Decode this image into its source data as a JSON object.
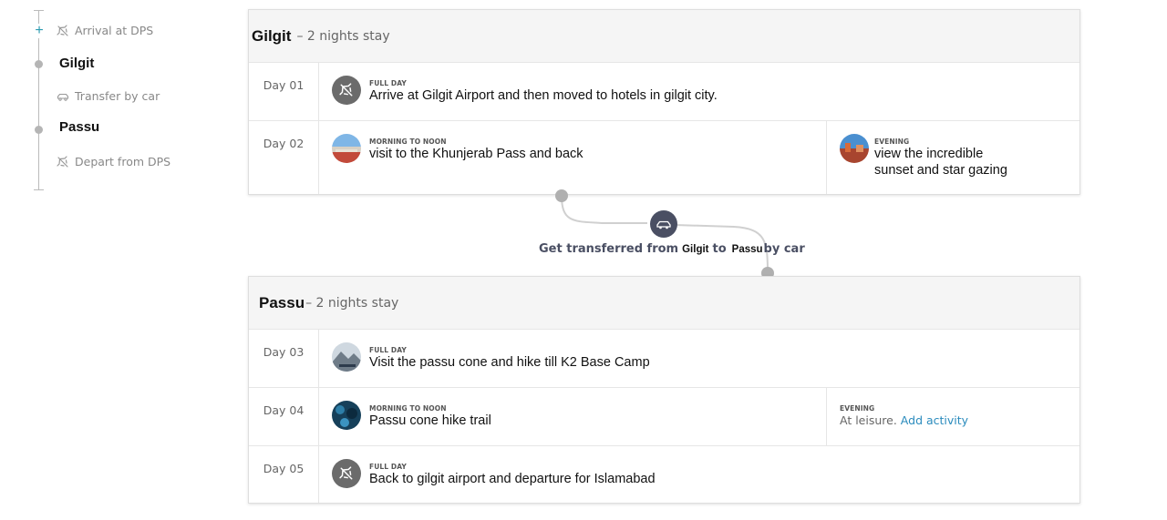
{
  "sidebar": {
    "arrival": "Arrival at DPS",
    "city1": "Gilgit",
    "transfer": "Transfer by car",
    "city2": "Passu",
    "depart": "Depart from DPS"
  },
  "cards": [
    {
      "city": "Gilgit",
      "nights": "– 2 nights stay",
      "days": [
        {
          "day": "Day 01",
          "full": {
            "tag": "FULL DAY",
            "text": "Arrive at Gilgit Airport and then moved to hotels in gilgit city.",
            "icon": "plane-icon"
          }
        },
        {
          "day": "Day 02",
          "morning": {
            "tag": "MORNING TO NOON",
            "text": "visit to the Khunjerab Pass and back"
          },
          "evening": {
            "tag": "EVENING",
            "text": "view the incredible sunset and star gazing"
          }
        }
      ]
    },
    {
      "city": "Passu",
      "nights": "– 2 nights stay",
      "days": [
        {
          "day": "Day 03",
          "full": {
            "tag": "FULL DAY",
            "text": "Visit the passu cone and hike till K2 Base Camp"
          }
        },
        {
          "day": "Day 04",
          "morning": {
            "tag": "MORNING TO NOON",
            "text": "Passu cone hike trail"
          },
          "evening": {
            "tag": "EVENING",
            "text": "At leisure.",
            "link": "Add activity"
          }
        },
        {
          "day": "Day 05",
          "full": {
            "tag": "FULL DAY",
            "text": "Back to gilgit airport and departure for Islamabad",
            "icon": "plane-icon"
          }
        }
      ]
    }
  ],
  "transfer": {
    "prefix": "Get transferred from",
    "from": "Gilgit",
    "to_word": "to",
    "to": "Passu",
    "suffix": "by car",
    "icon": "car-icon"
  },
  "colors": {
    "accent": "#2a9ab0",
    "link": "#2a8bbd",
    "transfer_text": "#4a4f63",
    "connector": "#d0d0d0",
    "connector_dot": "#b0b0b0",
    "car_badge": "#4a4f63"
  }
}
